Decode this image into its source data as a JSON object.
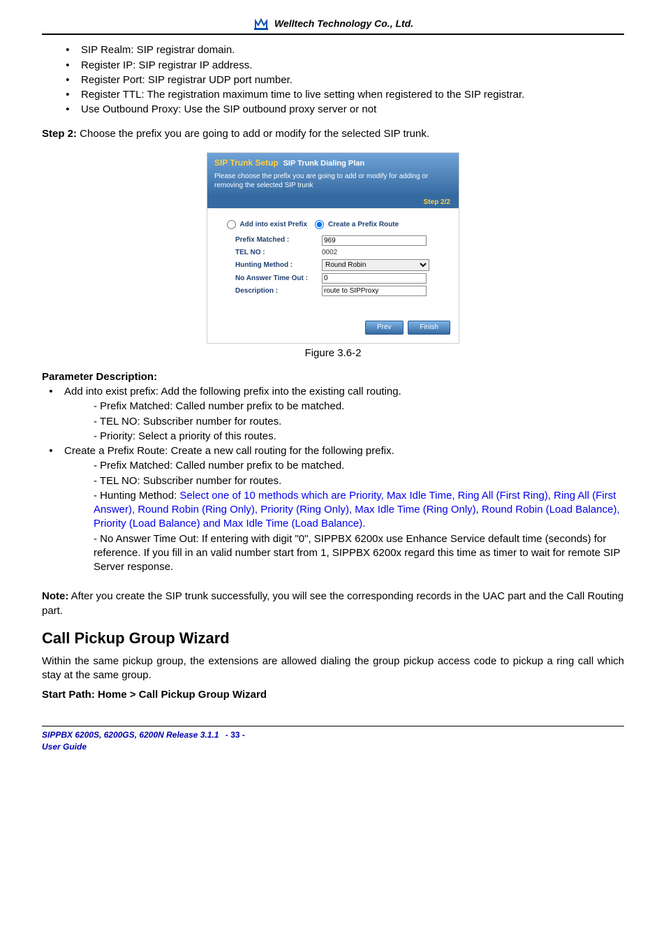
{
  "header": {
    "company": "Welltech Technology Co., Ltd."
  },
  "top_list": [
    "SIP Realm: SIP registrar domain.",
    "Register IP: SIP registrar IP address.",
    "Register Port: SIP registrar UDP port number.",
    "Register TTL: The registration maximum time to live setting when registered to the SIP registrar.",
    "Use Outbound Proxy: Use the SIP outbound proxy server or not"
  ],
  "step2": {
    "label": "Step 2:",
    "rest": " Choose the prefix you are going to add or modify for the selected SIP trunk."
  },
  "figure": {
    "caption": "Figure 3.6-2",
    "hdr_title": "SIP Trunk Setup",
    "hdr_sub": "SIP Trunk Dialing Plan",
    "hdr_desc": "Please choose the prefix you are going to add or modify for adding or removing the selected SIP trunk",
    "step": "Step 2/2",
    "radio_exist": "Add into exist Prefix",
    "radio_create": "Create a Prefix Route",
    "labels": {
      "prefix": "Prefix Matched :",
      "telno": "TEL NO :",
      "hunt": "Hunting Method :",
      "noans": "No Answer Time Out :",
      "desc": "Description :"
    },
    "values": {
      "prefix": "969",
      "telno": "0002",
      "hunt": "Round Robin",
      "noans": "0",
      "desc": "route to SIPProxy"
    },
    "btn_prev": "Prev",
    "btn_finish": "Finish"
  },
  "paramdesc": {
    "title": "Parameter Description:",
    "add_exist": "Add into exist prefix: Add the following prefix into the existing call routing.",
    "add_exist_sub": [
      "Prefix Matched: Called number prefix to be matched.",
      "TEL NO: Subscriber number for routes.",
      "Priority: Select a priority of this routes."
    ],
    "create_route": "Create a Prefix Route: Create a new call routing for the following prefix.",
    "create_sub_prefix": "Prefix Matched: Called number prefix to be matched.",
    "create_sub_telno": "TEL NO: Subscriber number for routes.",
    "create_sub_hunt_lead": "Hunting Method: ",
    "create_sub_hunt_blue": "Select one of 10 methods which are Priority, Max Idle Time, Ring All (First Ring), Ring All (First Answer), Round Robin (Ring Only), Priority (Ring Only), Max Idle Time (Ring Only), Round Robin (Load Balance), Priority (Load Balance) and Max Idle Time (Load Balance).",
    "create_sub_noans": "No Answer Time Out: If entering with digit \"0\", SIPPBX 6200x use Enhance Service default time (seconds) for reference. If you fill in an valid number start from 1, SIPPBX 6200x regard this time as timer to wait for remote SIP Server response."
  },
  "note": {
    "label": "Note:",
    "rest": " After you create the SIP trunk successfully, you will see the corresponding records in the UAC part and the Call Routing part."
  },
  "section_title": "Call Pickup Group Wizard",
  "section_body": "Within the same pickup group, the extensions are allowed dialing the group pickup access code to pickup a ring call which stay at the same group.",
  "start_path": "Start Path: Home > Call Pickup Group Wizard",
  "footer": {
    "line1": "SIPPBX 6200S, 6200GS, 6200N   Release 3.1.1",
    "line2": "User Guide",
    "pagenum": "- 33 -"
  }
}
